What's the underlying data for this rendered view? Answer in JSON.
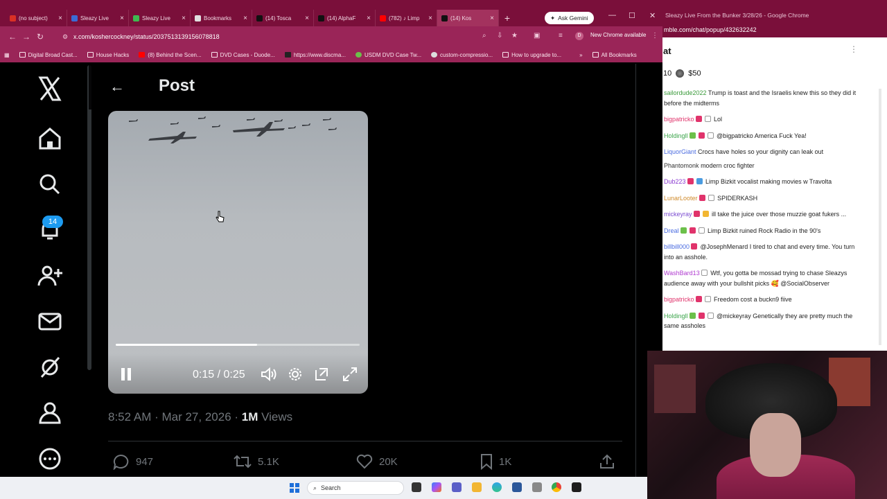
{
  "browser": {
    "tabs": [
      {
        "title": "(no subject)",
        "color": "#d93025"
      },
      {
        "title": "Sleazy Live",
        "color": "#3b6bd6"
      },
      {
        "title": "Sleazy Live",
        "color": "#3fb950"
      },
      {
        "title": "Bookmarks",
        "color": "#e0e0e0"
      },
      {
        "title": "(14) Tosca",
        "color": "#111111"
      },
      {
        "title": "(14) AlphaF",
        "color": "#111111"
      },
      {
        "title": "(782) ♪ Limp",
        "color": "#ff0000"
      },
      {
        "title": "(14) Kos",
        "color": "#111111"
      }
    ],
    "ask_gemini": "Ask Gemini",
    "url": "x.com/koshercockney/status/2037513139156078818",
    "new_chrome": "New Chrome available",
    "profile_initial": "D",
    "bookmarks": [
      "Digital Broad Cast...",
      "House Hacks",
      "(8) Behind the Scen...",
      "DVD Cases - Duode...",
      "https://www.discma...",
      "USDM DVD Case Tw...",
      "custom-compressio...",
      "How to upgrade to..."
    ],
    "all_bookmarks": "All Bookmarks"
  },
  "x": {
    "page_title": "Post",
    "notification_count": "14",
    "video": {
      "time": "0:15 / 0:25",
      "progress": 0.58
    },
    "post_time": "8:52 AM · Mar 27, 2026 · ",
    "views_count": "1M",
    "views_label": " Views",
    "replies": "947",
    "reposts": "5.1K",
    "likes": "20K",
    "bookmarks": "1K"
  },
  "taskbar": {
    "search": "Search"
  },
  "chat": {
    "window_title": "Sleazy Live From the Bunker 3/28/26 - Google Chrome",
    "url": "mble.com/chat/popup/432632242",
    "header": "at",
    "stats_count": "10",
    "stats_amount": "$50",
    "messages": [
      {
        "user": "sailordude2022",
        "color": "#3a9a3a",
        "text": "Trump is toast and the Israelis knew this so they did it before the midterms"
      },
      {
        "user": "bigpatricko",
        "color": "#e0336b",
        "text": "Lol"
      },
      {
        "user": "Holdingll",
        "color": "#3aa54a",
        "text": "@bigpatricko America Fuck Yea!"
      },
      {
        "user": "LiquorGiant",
        "color": "#4a6be0",
        "text": "Crocs have holes so your dignity can leak out"
      },
      {
        "user": "Phantomonk",
        "color": "#333333",
        "text": "modern croc fighter"
      },
      {
        "user": "Dub223",
        "color": "#8a3ad0",
        "text": "Limp Bizkit vocalist making movies w Travolta"
      },
      {
        "user": "LunarLooter",
        "color": "#d08a2a",
        "text": "SPIDERKASH"
      },
      {
        "user": "mickeyray",
        "color": "#7a4ad0",
        "text": "ill take the juice over those muzzie goat fukers ..."
      },
      {
        "user": "Dreal",
        "color": "#4a6be0",
        "text": "Limp Bizkit ruined Rock Radio in the 90's"
      },
      {
        "user": "billbill000",
        "color": "#4a6be0",
        "text": "@JosephMenard I tired to chat and every time. You turn into an asshole."
      },
      {
        "user": "WashBard13",
        "color": "#b03ad0",
        "text": "Wtf, you gotta be mossad trying to chase Sleazys audience away with your bullshit picks 🥰 @SocialObserver"
      },
      {
        "user": "bigpatricko",
        "color": "#e0336b",
        "text": "Freedom cost a buckn9 fiive"
      },
      {
        "user": "Holdingll",
        "color": "#3aa54a",
        "text": "@mickeyray Genetically they are pretty much the same assholes"
      }
    ]
  }
}
